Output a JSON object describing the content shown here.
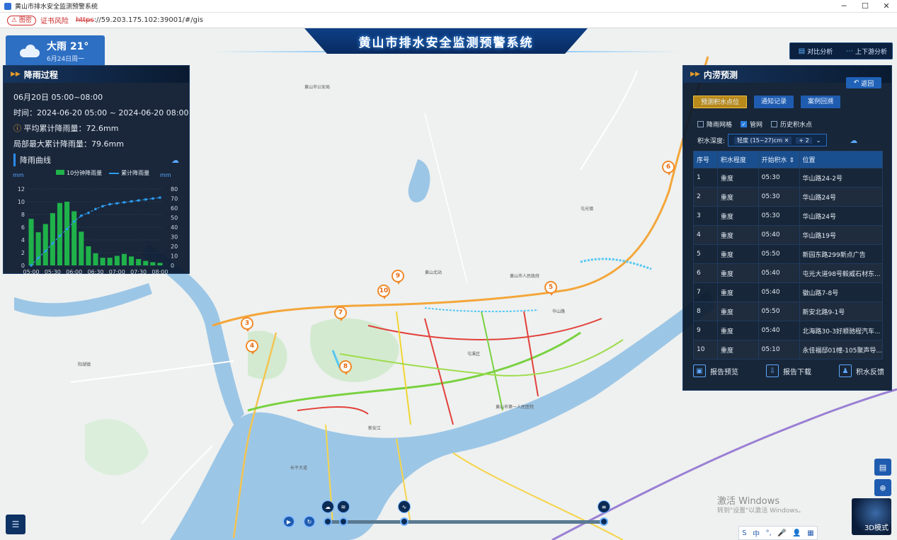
{
  "browser": {
    "window_title": "黄山市排水安全监测预警系统",
    "security_badge": "⚠ 图密",
    "security_text": "证书风险",
    "url_scheme": "https",
    "url_rest": "://59.203.175.102:39001/#/gis",
    "min": "─",
    "max": "☐",
    "close": "✕"
  },
  "header": {
    "title": "黄山市排水安全监测预警系统"
  },
  "weather": {
    "summary": "大雨 21°",
    "date": "6月24日周一"
  },
  "rain_panel": {
    "title": "降雨过程",
    "range": "06月20日 05:00~08:00",
    "time": "时间：2024-06-20 05:00 ~ 2024-06-20 08:00",
    "avg": "平均累计降雨量：72.6mm",
    "max": "局部最大累计降雨量：79.6mm",
    "curve_title": "降雨曲线",
    "unit_left": "mm",
    "unit_right": "mm",
    "legend_bar": "10分钟降雨量",
    "legend_line": "累计降雨量"
  },
  "chart_data": {
    "type": "bar",
    "x": [
      "05:00",
      "05:10",
      "05:20",
      "05:30",
      "05:40",
      "05:50",
      "06:00",
      "06:10",
      "06:20",
      "06:30",
      "06:40",
      "06:50",
      "07:00",
      "07:10",
      "07:20",
      "07:30",
      "07:40",
      "07:50",
      "08:00"
    ],
    "x_tick_labels": [
      "05:00",
      "05:30",
      "06:00",
      "06:30",
      "07:00",
      "07:30",
      "08:00"
    ],
    "series": [
      {
        "name": "10分钟降雨量",
        "type": "bar",
        "axis": "left",
        "values": [
          7.3,
          5.2,
          6.5,
          8.2,
          9.8,
          10.0,
          8.5,
          5.3,
          3.0,
          1.9,
          1.2,
          1.2,
          1.5,
          1.8,
          1.4,
          1.0,
          0.7,
          0.5,
          0.4
        ]
      },
      {
        "name": "累计降雨量",
        "type": "line",
        "axis": "right",
        "values": [
          0,
          8,
          15,
          23,
          31,
          38,
          46,
          52,
          55,
          59,
          62,
          64,
          65,
          66,
          67,
          68,
          69,
          70,
          71
        ]
      }
    ],
    "ylim_left": [
      0,
      12
    ],
    "yticks_left": [
      0,
      2,
      4,
      6,
      8,
      10,
      12
    ],
    "ylim_right": [
      0,
      80
    ],
    "yticks_right": [
      0,
      10,
      20,
      30,
      40,
      50,
      60,
      70,
      80
    ],
    "colors": {
      "bar": "#1fb24a",
      "line": "#2c9cf0"
    },
    "grid": true,
    "legend_position": "top"
  },
  "top_right": {
    "compare": "对比分析",
    "updown": "上下游分析"
  },
  "waterlog_panel": {
    "title": "内涝预测",
    "back": "返回",
    "tabs": [
      "预测积水点位",
      "通知记录",
      "案例回溯"
    ],
    "checks": [
      {
        "label": "降雨网格",
        "checked": false
      },
      {
        "label": "管网",
        "checked": true
      },
      {
        "label": "历史积水点",
        "checked": false
      }
    ],
    "depth_label": "积水深度:",
    "depth_value": "轻度 (15~27)cm",
    "depth_more": "+ 2",
    "columns": [
      "序号",
      "积水程度",
      "开始积水 ⇕",
      "位置"
    ],
    "rows": [
      [
        "1",
        "重度",
        "05:30",
        "华山路24-2号"
      ],
      [
        "2",
        "重度",
        "05:30",
        "华山路24号"
      ],
      [
        "3",
        "重度",
        "05:30",
        "华山路24号"
      ],
      [
        "4",
        "重度",
        "05:40",
        "华山路19号"
      ],
      [
        "5",
        "重度",
        "05:50",
        "新园东路299新点广告"
      ],
      [
        "6",
        "重度",
        "05:40",
        "屯光大道98号毅威石材东..."
      ],
      [
        "7",
        "重度",
        "05:40",
        "徽山路7-8号"
      ],
      [
        "8",
        "重度",
        "05:50",
        "新安北路9-1号"
      ],
      [
        "9",
        "重度",
        "05:40",
        "北海路30-3好顺驰程汽车..."
      ],
      [
        "10",
        "重度",
        "05:10",
        "永佳福邸01幢-105聚声导..."
      ]
    ],
    "footer": [
      "报告预览",
      "报告下载",
      "积水反馈"
    ]
  },
  "markers": [
    "3",
    "4",
    "5",
    "6",
    "7",
    "8",
    "9",
    "10"
  ],
  "map_labels": [
    "黄山市公安局",
    "黄山市人民政府",
    "屯溪区",
    "黄山市第一人民医院",
    "长干大道",
    "新安江",
    "黄山北站",
    "阳湖镇",
    "屯光镇",
    "华山路"
  ],
  "timeline": {
    "play": "▶",
    "replay": "↻"
  },
  "bottom_right": {
    "mode": "3D模式"
  },
  "watermark": {
    "line1": "激活 Windows",
    "line2": "转到\"设置\"以激活 Windows。"
  },
  "ime": [
    "S",
    "中",
    "°,",
    "🎤",
    "👤",
    "▦"
  ]
}
